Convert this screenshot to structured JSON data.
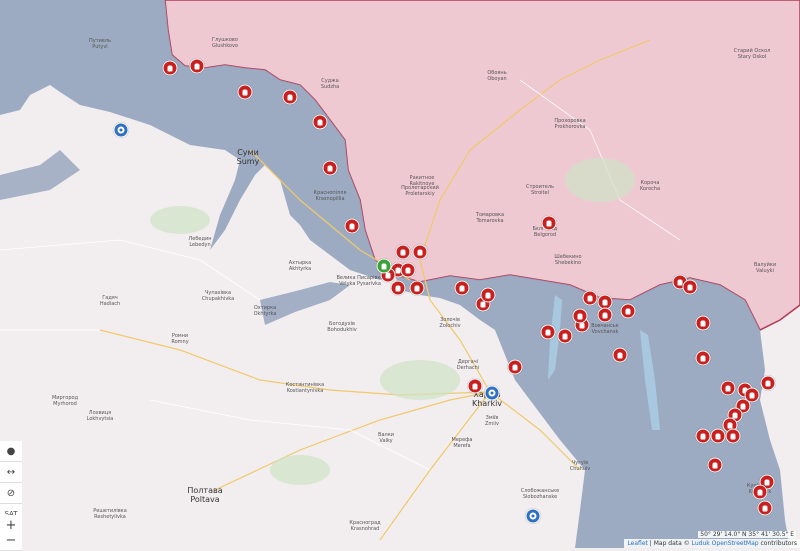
{
  "colors": {
    "russia": "#efc9d2",
    "occupied": "#94a3bd",
    "ukraine": "#f2eef0",
    "red_marker": "#c9201f",
    "blue_marker": "#2f6fc4",
    "water": "#a8c8e0"
  },
  "cities": [
    {
      "ru": "Суми",
      "en": "Sumy",
      "big": true
    },
    {
      "ru": "Полтава",
      "en": "Poltava",
      "big": true
    },
    {
      "ru": "Харків",
      "en": "Kharkiv",
      "big": true
    },
    {
      "ru": "Бєлгород",
      "en": "Belgorod",
      "big": false
    },
    {
      "ru": "Старий Оскол",
      "en": "Stary Oskol",
      "big": false
    },
    {
      "ru": "Путивль",
      "en": "Putyvl",
      "big": false
    },
    {
      "ru": "Глушково",
      "en": "Glushkovo",
      "big": false
    },
    {
      "ru": "Суджа",
      "en": "Sudzha",
      "big": false
    },
    {
      "ru": "Обоянь",
      "en": "Oboyan",
      "big": false
    },
    {
      "ru": "Прохоровка",
      "en": "Prokhorovka",
      "big": false
    },
    {
      "ru": "Ракитное",
      "en": "Rakitnoye",
      "big": false
    },
    {
      "ru": "Пролетарский",
      "en": "Proletarskiy",
      "big": false
    },
    {
      "ru": "Томаровка",
      "en": "Tomarovka",
      "big": false
    },
    {
      "ru": "Строитель",
      "en": "Stroitel",
      "big": false
    },
    {
      "ru": "Короча",
      "en": "Korocha",
      "big": false
    },
    {
      "ru": "Лебедин",
      "en": "Lebedyn",
      "big": false
    },
    {
      "ru": "Охтирка",
      "en": "Okhtyrka",
      "big": false
    },
    {
      "ru": "Краснопілля",
      "en": "Krasnopillia",
      "big": false
    },
    {
      "ru": "Велика Писарівка",
      "en": "Velyka Pysarivka",
      "big": false
    },
    {
      "ru": "Гадяч",
      "en": "Hadiach",
      "big": false
    },
    {
      "ru": "Чупахівка",
      "en": "Chupakhivka",
      "big": false
    },
    {
      "ru": "Ромни",
      "en": "Romny",
      "big": false
    },
    {
      "ru": "Богодухів",
      "en": "Bohodukhiv",
      "big": false
    },
    {
      "ru": "Золочів",
      "en": "Zolochiv",
      "big": false
    },
    {
      "ru": "Дергачі",
      "en": "Derhachi",
      "big": false
    },
    {
      "ru": "Вовчанськ",
      "en": "Vovchansk",
      "big": false
    },
    {
      "ru": "Чугуїв",
      "en": "Chuhuiv",
      "big": false
    },
    {
      "ru": "Валки",
      "en": "Valky",
      "big": false
    },
    {
      "ru": "Мерефа",
      "en": "Merefa",
      "big": false
    },
    {
      "ru": "Зміїв",
      "en": "Zmiiv",
      "big": false
    },
    {
      "ru": "Куп'янськ",
      "en": "Kupiansk",
      "big": false
    },
    {
      "ru": "Шебекино",
      "en": "Shebekino",
      "big": false
    },
    {
      "ru": "Валуйки",
      "en": "Valuyki",
      "big": false
    },
    {
      "ru": "Миргород",
      "en": "Myrhorod",
      "big": false
    },
    {
      "ru": "Лохвиця",
      "en": "Lokhvytsia",
      "big": false
    },
    {
      "ru": "Ахтырка",
      "en": "Akhtyrka",
      "big": false
    },
    {
      "ru": "Костянтинівка",
      "en": "Kostiantynivka",
      "big": false
    },
    {
      "ru": "Красноград",
      "en": "Krasnohrad",
      "big": false
    },
    {
      "ru": "Решетилівка",
      "en": "Reshetylivka",
      "big": false
    },
    {
      "ru": "Слобожанське",
      "en": "Slobozhanske",
      "big": false
    }
  ],
  "controls": {
    "zoom_in": "+",
    "zoom_out": "−",
    "sat": "SAT"
  },
  "footer": {
    "leaflet": "Leaflet",
    "sep": " | Map data © ",
    "luduk": "Luduk",
    "osm": "OpenStreetMap",
    "contributors": " contributors"
  },
  "coords": "50° 29' 14.0\" N 35° 41' 30.5\" E"
}
